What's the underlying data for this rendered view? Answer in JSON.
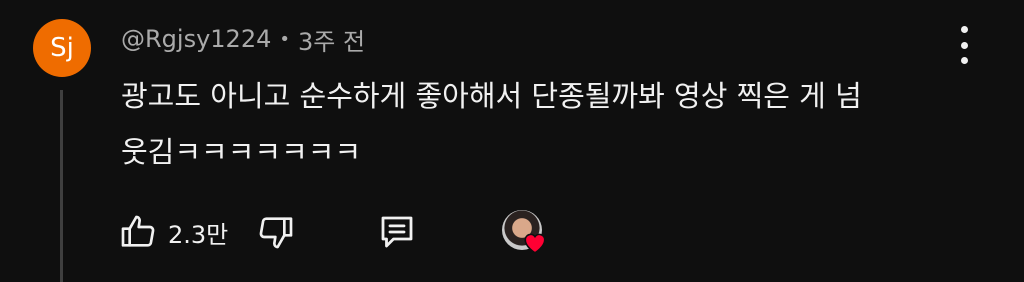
{
  "comment": {
    "avatar_letter": "Sj",
    "avatar_color": "#ef6c00",
    "username": "@Rgjsy1224",
    "separator": "•",
    "time": "3주 전",
    "text_line1": "광고도 아니고 순수하게 좋아해서 단종될까봐 영상 찍은 게 넘",
    "text_line2": "웃김ㅋㅋㅋㅋㅋㅋㅋ"
  },
  "actions": {
    "like_count": "2.3만",
    "icons": [
      "thumbs-up-icon",
      "thumbs-down-icon",
      "reply-icon",
      "creator-heart-icon"
    ]
  },
  "colors": {
    "background": "#0f0f0f",
    "text": "#f1f1f1",
    "secondary_text": "#aaaaaa",
    "heart": "#ff0033"
  }
}
